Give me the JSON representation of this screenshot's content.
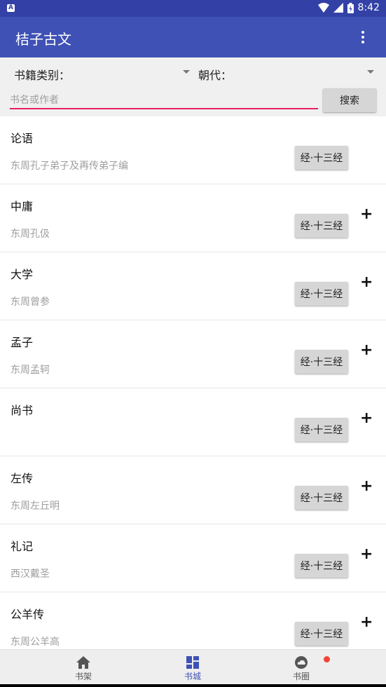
{
  "status_bar": {
    "time": "8:42"
  },
  "app_bar": {
    "title": "桔子古文"
  },
  "filters": {
    "category_label": "书籍类别：",
    "dynasty_label": "朝代："
  },
  "search": {
    "placeholder": "书名或作者",
    "value": "",
    "button_label": "搜索"
  },
  "books": [
    {
      "name": "论语",
      "author": "东周孔子弟子及再传弟子编",
      "tag": "经·十三经",
      "has_add": false
    },
    {
      "name": "中庸",
      "author": "东周孔伋",
      "tag": "经·十三经",
      "has_add": true
    },
    {
      "name": "大学",
      "author": "东周曾参",
      "tag": "经·十三经",
      "has_add": true
    },
    {
      "name": "孟子",
      "author": "东周孟轲",
      "tag": "经·十三经",
      "has_add": true
    },
    {
      "name": "尚书",
      "author": "",
      "tag": "经·十三经",
      "has_add": true
    },
    {
      "name": "左传",
      "author": "东周左丘明",
      "tag": "经·十三经",
      "has_add": true
    },
    {
      "name": "礼记",
      "author": "西汉戴圣",
      "tag": "经·十三经",
      "has_add": true
    },
    {
      "name": "公羊传",
      "author": "东周公羊高",
      "tag": "经·十三经",
      "has_add": true
    }
  ],
  "add_symbol": "+",
  "bottom_nav": [
    {
      "label": "书架",
      "icon": "home-icon",
      "active": false
    },
    {
      "label": "书城",
      "icon": "dashboard-icon",
      "active": true
    },
    {
      "label": "书圈",
      "icon": "cloud-icon",
      "active": false,
      "badge": true
    }
  ],
  "colors": {
    "primary": "#3f51b5",
    "primary_dark": "#3341a6",
    "accent": "#e91e63",
    "badge": "#f44336"
  }
}
